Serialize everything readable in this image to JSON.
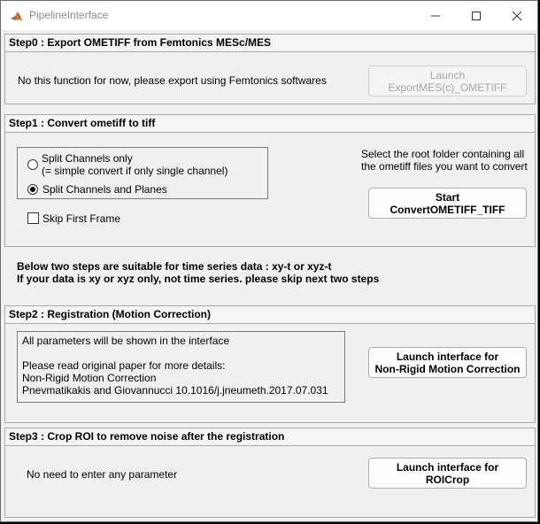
{
  "window": {
    "title": "PipelineInterface",
    "minimize_icon": "minimize-icon",
    "maximize_icon": "maximize-icon",
    "close_icon": "close-icon"
  },
  "step0": {
    "header": "Step0 : Export OMETIFF from Femtonics MESc/MES",
    "message": "No this function for now, please export using Femtonics softwares",
    "button_line1": "Launch",
    "button_line2": "ExportMES(c)_OMETIFF"
  },
  "step1": {
    "header": "Step1 : Convert ometiff to tiff",
    "radio1_line1": "Split Channels only",
    "radio1_line2": "(= simple convert if only single channel)",
    "radio2_label": "Split Channels and Planes",
    "radio_selected": 2,
    "skip_label": "Skip First Frame",
    "skip_checked": false,
    "instruction_line1": "Select the root folder containing all",
    "instruction_line2": "the ometiff files you want to convert",
    "button_line1": "Start",
    "button_line2": "ConvertOMETIFF_TIFF"
  },
  "note": {
    "line1": "Below two steps are suitable for time series data : xy-t or xyz-t",
    "line2": "If your data is xy or xyz only, not time series. please skip next two steps"
  },
  "step2": {
    "header": "Step2 : Registration (Motion Correction)",
    "info_line1": "All parameters will be shown in the interface",
    "info_line2": "Please read original paper for more details:",
    "info_line3": "Non-Rigid Motion Correction",
    "info_line4": "Pnevmatikakis and Giovannucci 10.1016/j.jneumeth.2017.07.031",
    "button_line1": "Launch interface for",
    "button_line2": "Non-Rigid Motion Correction"
  },
  "step3": {
    "header": "Step3 : Crop ROI to remove noise after the registration",
    "message": "No need to enter any parameter",
    "button_line1": "Launch interface for",
    "button_line2": "ROICrop"
  }
}
